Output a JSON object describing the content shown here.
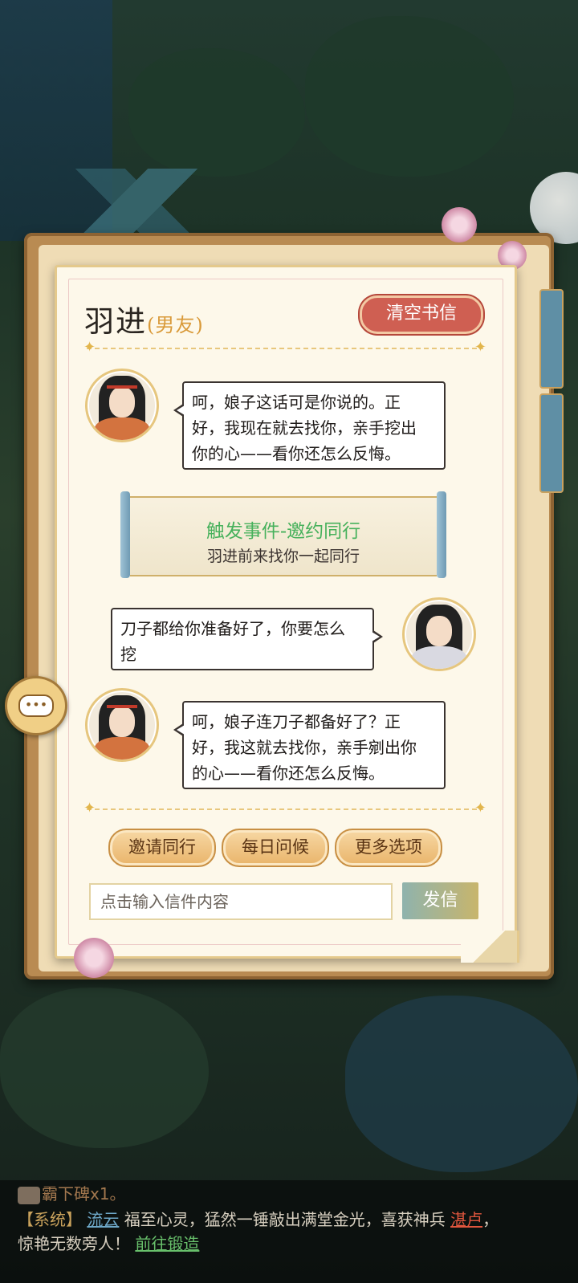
{
  "letter": {
    "name": "羽进",
    "relation": "(男友)",
    "clear_button": "清空书信"
  },
  "messages": [
    {
      "side": "left",
      "text_lines": [
        "呵，娘子这话可是你说的。正",
        "好，我现在就去找你，亲手挖出",
        "你的心——看你还怎么反悔。"
      ]
    },
    {
      "side": "right",
      "text_lines": [
        "刀子都给你准备好了，你要怎么",
        "挖"
      ]
    },
    {
      "side": "left",
      "text_lines": [
        "呵，娘子连刀子都备好了？正",
        "好，我这就去找你，亲手剜出你",
        "的心——看你还怎么反悔。"
      ]
    }
  ],
  "event": {
    "title": "触发事件-邀约同行",
    "desc": "羽进前来找你一起同行"
  },
  "options": [
    "邀请同行",
    "每日问候",
    "更多选项"
  ],
  "input": {
    "placeholder": "点击输入信件内容",
    "send_label": "发信"
  },
  "log": {
    "line1": "霸下碑x1。",
    "tag": "【系统】",
    "player": "流云",
    "text1": "福至心灵，猛然一锤敲出满堂金光，喜获神兵",
    "item": "湛卢",
    "comma": "，",
    "text2": "惊艳无数旁人！",
    "link": "前往锻造"
  },
  "colors": {
    "accent_red": "#cf5f52",
    "event_green": "#47b15c",
    "relation_orange": "#d99a3a"
  }
}
